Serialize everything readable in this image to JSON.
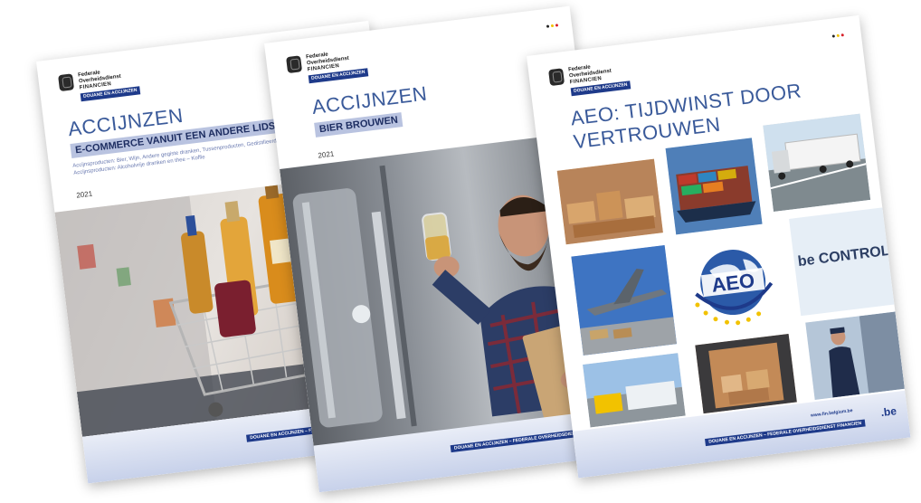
{
  "organization": {
    "line1": "Federale",
    "line2": "Overheidsdienst",
    "line3": "FINANCIEN",
    "department": "DOUANE EN ACCIJNZEN"
  },
  "brochures": [
    {
      "title": "ACCIJNZEN",
      "subtitle": "E-COMMERCE VANUIT EEN ANDERE LIDSTAAT NAAR",
      "description_line1": "Accijnsproducten: Bier, Wijn, Andere gegiste dranken, Tussenproducten, Gedistilleerde dranken",
      "description_line2": "Accijnsproducten: Alcoholvrije dranken en thee – Koffie",
      "year": "2021",
      "footer_tag": "DOUANE EN ACCIJNZEN – FEDERALE OVERHEIDSDIENST FINANCIEN"
    },
    {
      "title": "ACCIJNZEN",
      "subtitle": "BIER BROUWEN",
      "year": "2021",
      "footer_tag": "DOUANE EN ACCIJNZEN – FEDERALE OVERHEIDSDIENST FINANCIEN"
    },
    {
      "title_line1": "AEO: TIJDWINST DOOR",
      "title_line2": "VERTROUWEN",
      "logo_text": "AEO",
      "sign_text": "be  CONTROLE",
      "website": "www.fin.belgium.be",
      "footer_tag": "DOUANE EN ACCIJNZEN – FEDERALE OVERHEIDSDIENST FINANCIEN",
      "be_logo": ".be"
    }
  ],
  "colors": {
    "accent_blue": "#3a5a9a",
    "navy": "#1e3a8a",
    "band": "#b9c3e0",
    "flag_black": "#222222",
    "flag_yellow": "#f2c200",
    "flag_red": "#d6202a"
  },
  "icons": [
    "belgian-crest-icon",
    "flag-dots-icon",
    "aeo-globe-icon",
    "shopping-cart-icon"
  ]
}
